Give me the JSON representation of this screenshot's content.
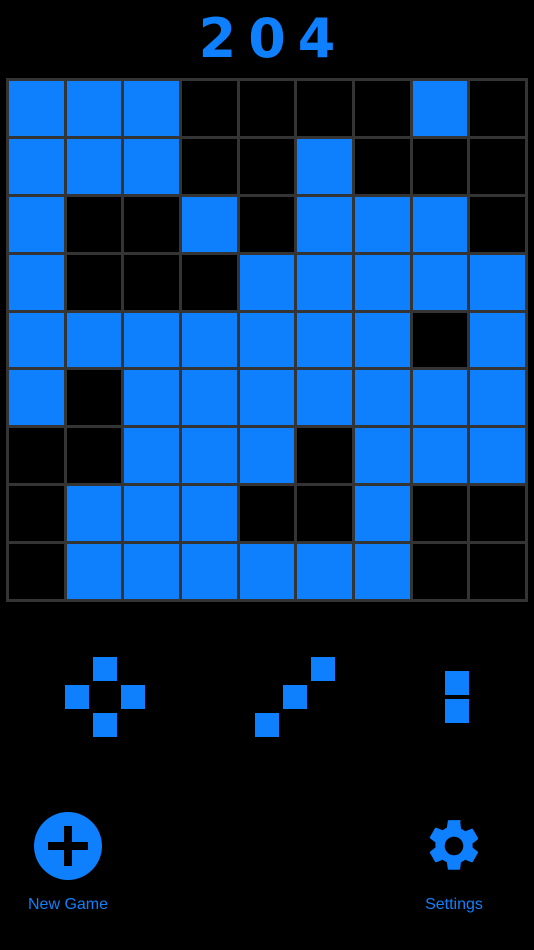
{
  "app": {
    "background_color": "#000000",
    "accent_color": "#0f80fd",
    "grid_line_color": "#343434"
  },
  "header": {
    "score_label": "204"
  },
  "board": {
    "rows": 9,
    "columns": 9,
    "filled_color": "#0f80fd",
    "empty_color": "#000000",
    "cells": [
      [
        1,
        1,
        1,
        0,
        0,
        0,
        0,
        1,
        0
      ],
      [
        1,
        1,
        1,
        0,
        0,
        1,
        0,
        0,
        0
      ],
      [
        1,
        0,
        0,
        1,
        0,
        1,
        1,
        1,
        0
      ],
      [
        1,
        0,
        0,
        0,
        1,
        1,
        1,
        1,
        1
      ],
      [
        1,
        1,
        1,
        1,
        1,
        1,
        1,
        0,
        1
      ],
      [
        1,
        0,
        1,
        1,
        1,
        1,
        1,
        1,
        1
      ],
      [
        0,
        0,
        1,
        1,
        1,
        0,
        1,
        1,
        1
      ],
      [
        0,
        1,
        1,
        1,
        0,
        0,
        1,
        0,
        0
      ],
      [
        0,
        1,
        1,
        1,
        1,
        1,
        1,
        0,
        0
      ]
    ]
  },
  "tray": {
    "pieces": [
      {
        "name": "diamond-piece",
        "rows": 3,
        "columns": 3,
        "cells": [
          [
            0,
            1,
            0
          ],
          [
            1,
            0,
            1
          ],
          [
            0,
            1,
            0
          ]
        ]
      },
      {
        "name": "diagonal-piece",
        "rows": 3,
        "columns": 3,
        "cells": [
          [
            0,
            0,
            1
          ],
          [
            0,
            1,
            0
          ],
          [
            1,
            0,
            0
          ]
        ]
      },
      {
        "name": "vertical-domino-piece",
        "rows": 2,
        "columns": 1,
        "cells": [
          [
            1
          ],
          [
            1
          ]
        ]
      }
    ]
  },
  "actions": {
    "new_game": {
      "label": "New Game",
      "icon": "plus-circle-icon"
    },
    "settings": {
      "label": "Settings",
      "icon": "gear-icon"
    }
  }
}
